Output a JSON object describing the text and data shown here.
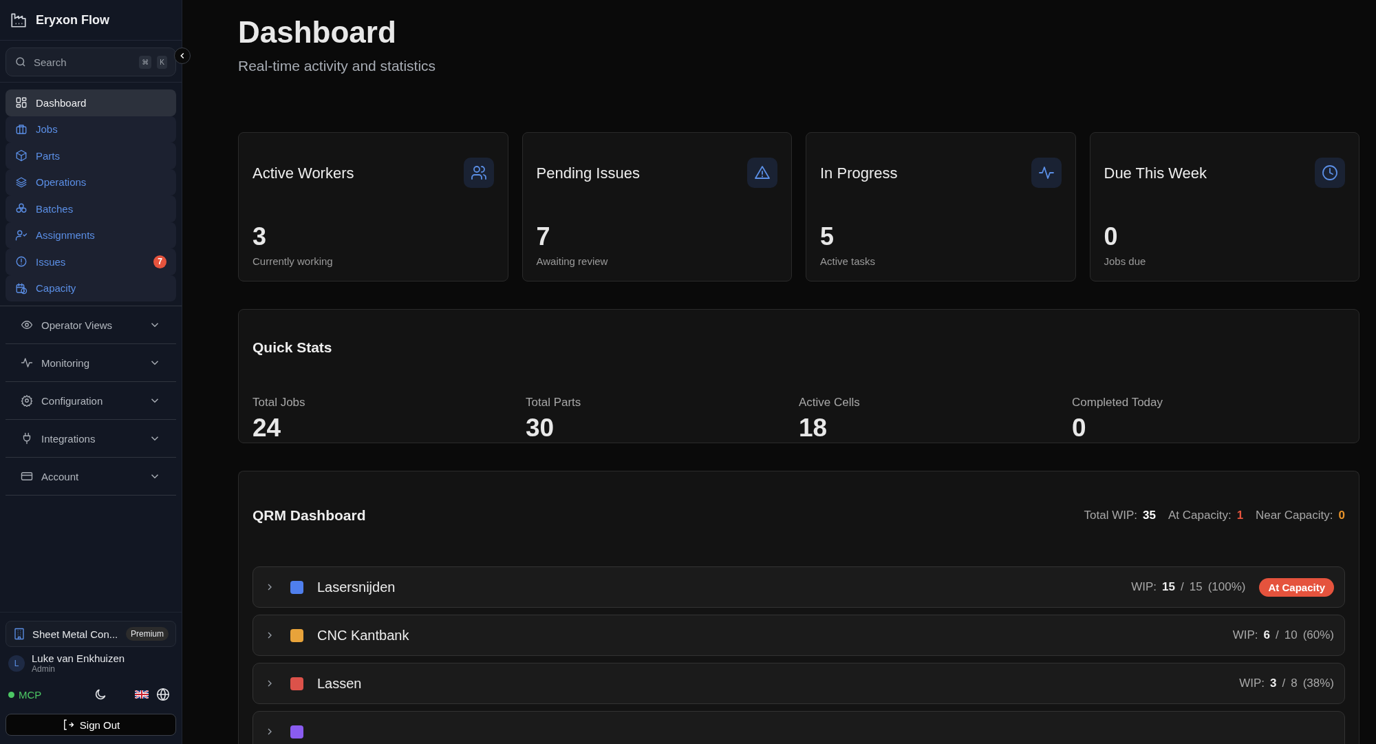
{
  "sidebar": {
    "brand": "Eryxon Flow",
    "search": {
      "placeholder": "Search",
      "keys": [
        "⌘",
        "K"
      ]
    },
    "items": [
      {
        "label": "Dashboard",
        "selected": true
      },
      {
        "label": "Jobs",
        "selected": false
      },
      {
        "label": "Parts",
        "selected": false
      },
      {
        "label": "Operations",
        "selected": false
      },
      {
        "label": "Batches",
        "selected": false
      },
      {
        "label": "Assignments",
        "selected": false
      },
      {
        "label": "Issues",
        "selected": false,
        "badge": "7"
      },
      {
        "label": "Capacity",
        "selected": false
      }
    ],
    "groups": [
      {
        "label": "Operator Views",
        "expanded": false
      },
      {
        "label": "Monitoring",
        "expanded": false
      },
      {
        "label": "Configuration",
        "expanded": false
      },
      {
        "label": "Integrations",
        "expanded": false
      },
      {
        "label": "Account",
        "expanded": false
      }
    ],
    "organization": {
      "name": "Sheet Metal Con...",
      "plan": "Premium"
    },
    "user": {
      "initial": "L",
      "name": "Luke van Enkhuizen",
      "role": "Admin"
    },
    "mcp": {
      "label": "MCP",
      "on": true
    },
    "sign_out": "Sign Out"
  },
  "header": {
    "title": "Dashboard",
    "subtitle": "Real-time activity and statistics"
  },
  "stat_cards": [
    {
      "title": "Active Workers",
      "value": "3",
      "caption": "Currently working"
    },
    {
      "title": "Pending Issues",
      "value": "7",
      "caption": "Awaiting review"
    },
    {
      "title": "In Progress",
      "value": "5",
      "caption": "Active tasks"
    },
    {
      "title": "Due This Week",
      "value": "0",
      "caption": "Jobs due"
    }
  ],
  "quick_stats": {
    "title": "Quick Stats",
    "items": [
      {
        "label": "Total Jobs",
        "value": "24"
      },
      {
        "label": "Total Parts",
        "value": "30"
      },
      {
        "label": "Active Cells",
        "value": "18"
      },
      {
        "label": "Completed Today",
        "value": "0"
      }
    ]
  },
  "qrm": {
    "title": "QRM Dashboard",
    "summary": [
      {
        "label": "Total WIP:",
        "value": "35"
      },
      {
        "label": "At Capacity:",
        "value": "1"
      },
      {
        "label": "Near Capacity:",
        "value": "0"
      }
    ],
    "cells": [
      {
        "name": "Lasersnijden",
        "color": "#4f7fed",
        "expanded": false,
        "wip_label": "WIP:",
        "current": "15",
        "separator": "/",
        "limit": "15",
        "percent": "(100%)",
        "status": "At Capacity"
      },
      {
        "name": "CNC Kantbank",
        "color": "#e8a33a",
        "expanded": false,
        "wip_label": "WIP:",
        "current": "6",
        "separator": "/",
        "limit": "10",
        "percent": "(60%)"
      },
      {
        "name": "Lassen",
        "color": "#dc524a",
        "expanded": false,
        "wip_label": "WIP:",
        "current": "3",
        "separator": "/",
        "limit": "8",
        "percent": "(38%)"
      },
      {
        "color": "#8a5cf0",
        "expanded": false
      }
    ]
  }
}
